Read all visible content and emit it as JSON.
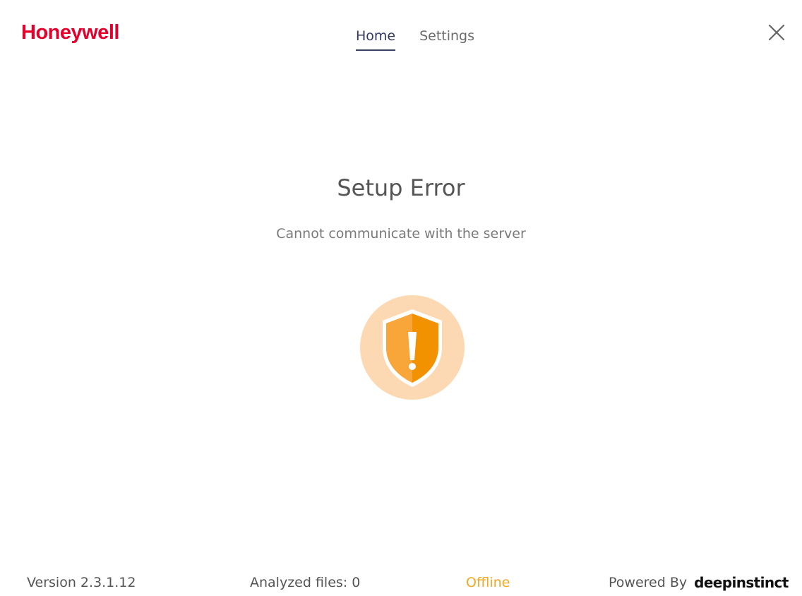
{
  "header": {
    "logo": "Honeywell",
    "tabs": [
      {
        "label": "Home",
        "active": true
      },
      {
        "label": "Settings",
        "active": false
      }
    ],
    "close_icon": "close-icon"
  },
  "main": {
    "title": "Setup Error",
    "message": "Cannot communicate with the server",
    "status_icon": "shield-warning-icon"
  },
  "footer": {
    "version": "Version 2.3.1.12",
    "analyzed_files": "Analyzed files: 0",
    "status": "Offline",
    "powered_by": "Powered By",
    "brand": "deepinstinct"
  },
  "colors": {
    "brand_red": "#e4002b",
    "warning_orange": "#f39200",
    "warning_orange_light": "#f8a53a",
    "halo": "#fcd9b2",
    "offline": "#f5a623",
    "nav_active": "#3b3f63"
  }
}
